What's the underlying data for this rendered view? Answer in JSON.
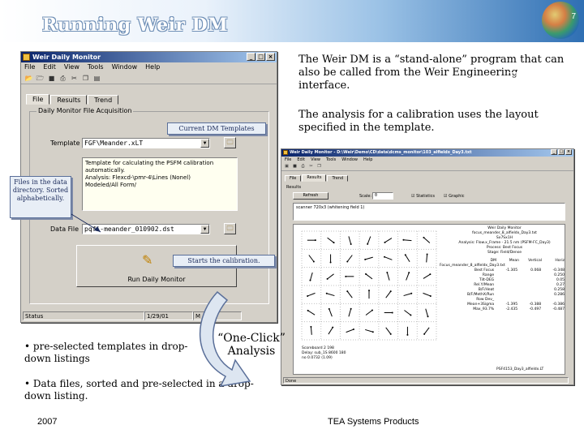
{
  "slide": {
    "title": "Running Weir DM",
    "number": "7",
    "brand": "TEA Systems",
    "footer_year": "2007",
    "footer_company": "TEA Systems Products"
  },
  "paragraphs": {
    "p1": "The Weir DM is a “stand-alone” program that can also be called from the Weir Engineering interface.",
    "p2": "The analysis for a calibration uses the layout specified in the template."
  },
  "bullets": [
    "pre-selected templates in drop-down listings",
    "Data files, sorted and pre-selected in a drop-down listing."
  ],
  "one_click": "“One-Click” Analysis",
  "callouts": {
    "templates": "Current DM Templates",
    "files": "Files in the data directory. Sorted alphabetically.",
    "calibration": "Starts the calibration."
  },
  "main_window": {
    "title": "Weir Daily Monitor",
    "menu": [
      "File",
      "Edit",
      "View",
      "Tools",
      "Window",
      "Help"
    ],
    "tabs": [
      "File",
      "Results",
      "Trend"
    ],
    "group_label": "Daily Monitor File Acquisition",
    "template_label": "Template",
    "template_value": "FGF\\Meander.xLT",
    "description": "Template for calculating the PSFM calibration automatically.\nAnalysis: Flexcd-\\pmr-4\\Lines (Nonel)\nModeled/All Form/",
    "datafile_label": "Data File",
    "datafile_value": "pqfi-meander_010902.dst",
    "run_label": "Run Daily Monitor",
    "status_text": "Status",
    "status_date": "1/29/01",
    "status_time": "M"
  },
  "results_window": {
    "title": "Weir Daily Monitor - D:\\Weir\\Demo\\CD\\data\\dcms_monitor\\103_alfieldx_Day3.txt",
    "menu": [
      "File",
      "Edit",
      "View",
      "Tools",
      "Window",
      "Help"
    ],
    "tabs": [
      "File",
      "Results",
      "Trend"
    ],
    "group_label": "Results",
    "refresh_label": "Refresh",
    "scale_label": "Scale:",
    "scale_value": "0",
    "statistics_label": "Statistics",
    "graphic_label": "Graphic",
    "log_line": "scanner 720x3 (whitening field 1)",
    "stats_lines": [
      "Weir Daily Monitor",
      "focus_meander_8_alfieldx_Day3.txt",
      "Sx7Sx1H",
      "Analysis: Flow.x_Frame - 21.5 nm (PSFM-FC_Day3)",
      "Process: Best Focus",
      "Stage: Field/Dense"
    ],
    "stats_header": [
      "DM Focus_meander_8_alfieldx_Day3.txt",
      "Mean",
      "Vertical",
      "Horiz"
    ],
    "stats_rows": [
      [
        "Best Focus",
        "-1.305",
        "0.068",
        "-0.348"
      ],
      [
        "Range",
        "",
        "",
        "0.250"
      ],
      [
        "Tilt-DEG",
        "",
        "",
        "0.05"
      ],
      [
        "Rel.Y/Mean",
        "",
        "",
        "0.27"
      ],
      [
        "B/F/Heat",
        "",
        "",
        "0.258"
      ],
      [
        "B/F/MethX/Run",
        "",
        "",
        "0.286"
      ],
      [
        "Row Dev_",
        "",
        "",
        ""
      ],
      [
        "Mean+3Sigma",
        "-1.395",
        "-0.388",
        "-0.386"
      ],
      [
        "Max_93.7%",
        "-2.435",
        "-0.497",
        "-0.487"
      ]
    ],
    "bottom_lines": [
      "Scoreboard 2 198",
      "Delay: sub_1S 8600 180",
      "no 0.0732 (1.09)"
    ],
    "plot_label": "PSF4153_Day3_alfieldx.LT",
    "status": "Done"
  }
}
